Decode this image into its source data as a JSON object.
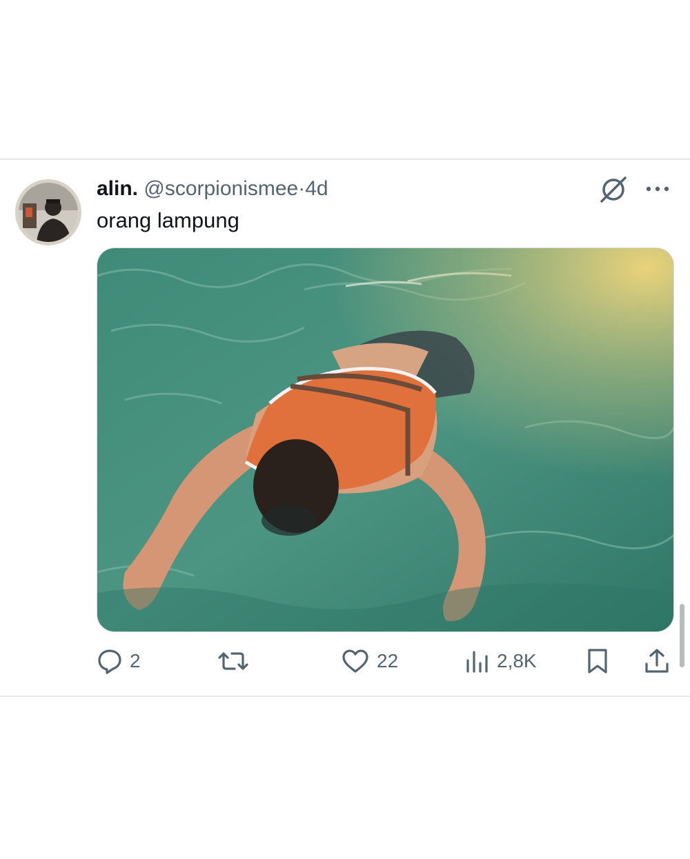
{
  "tweet": {
    "display_name": "alin.",
    "handle": "@scorpionismee",
    "separator": "·",
    "time": "4d",
    "text": "orang lampung",
    "media": {
      "icon": "photo-swimmer-life-vest"
    }
  },
  "actions": {
    "reply": {
      "icon": "reply-icon",
      "count": "2"
    },
    "retweet": {
      "icon": "retweet-icon",
      "count": ""
    },
    "like": {
      "icon": "heart-icon",
      "count": "22"
    },
    "views": {
      "icon": "views-icon",
      "count": "2,8K"
    },
    "bookmark": {
      "icon": "bookmark-icon"
    },
    "share": {
      "icon": "share-icon"
    }
  },
  "colors": {
    "text_primary": "#0f1419",
    "text_secondary": "#536471",
    "divider": "#e6e8ea"
  }
}
